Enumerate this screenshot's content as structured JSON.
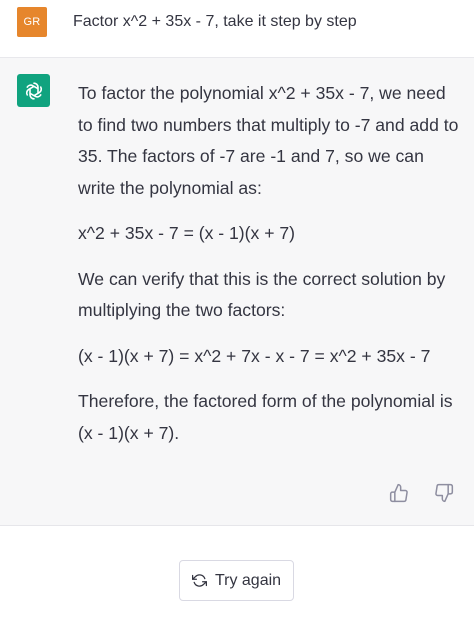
{
  "user_message": {
    "avatar_initials": "GR",
    "avatar_color": "#e6862c",
    "text": "Factor x^2 + 35x - 7, take it step by step"
  },
  "assistant_message": {
    "avatar_icon": "openai-logo-icon",
    "avatar_color": "#10a37f",
    "paragraphs": [
      "To factor the polynomial x^2 + 35x - 7, we need to find two numbers that multiply to -7 and add to 35. The factors of -7 are -1 and 7, so we can write the polynomial as:",
      "x^2 + 35x - 7 = (x - 1)(x + 7)",
      "We can verify that this is the correct solution by multiplying the two factors:",
      "(x - 1)(x + 7) = x^2 + 7x - x - 7 = x^2 + 35x - 7",
      "Therefore, the factored form of the polynomial is (x - 1)(x + 7)."
    ],
    "feedback_icons": [
      "thumbs-up-icon",
      "thumbs-down-icon"
    ]
  },
  "actions": {
    "try_again_label": "Try again",
    "try_again_icon": "refresh-icon"
  }
}
